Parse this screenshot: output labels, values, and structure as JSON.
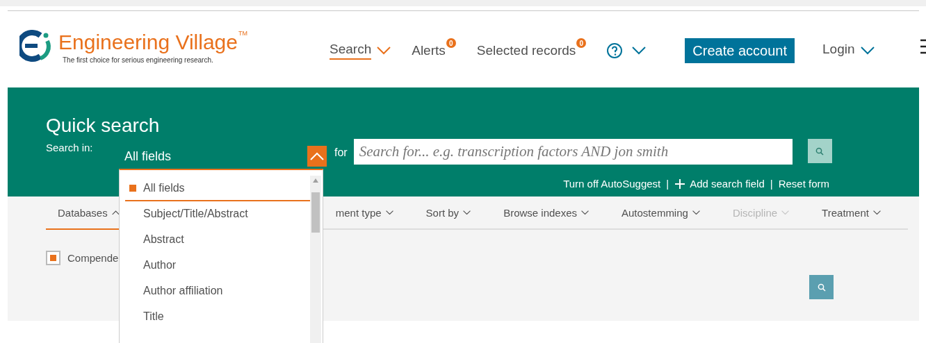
{
  "brand": {
    "name": "Engineering Village",
    "trademark": "TM",
    "tagline": "The first choice for serious engineering research."
  },
  "nav": [
    {
      "kind": "menu",
      "label": "Search",
      "selected": true
    },
    {
      "kind": "badge",
      "label": "Alerts",
      "badge": "0"
    },
    {
      "kind": "badge",
      "label": "Selected records",
      "badge": "0"
    },
    {
      "kind": "help"
    },
    {
      "kind": "button",
      "label": "Create account"
    },
    {
      "kind": "menu",
      "label": "Login",
      "selected": false
    }
  ],
  "quick_search": {
    "title": "Quick search",
    "search_in_label": "Search in:",
    "field_value": "All fields",
    "dropdown_expanded": true,
    "for_label": "for",
    "placeholder": "Search for... e.g. transcription factors AND jon smith",
    "links": [
      {
        "kind": "link",
        "label": "Turn off AutoSuggest"
      },
      {
        "kind": "separator",
        "label": "|"
      },
      {
        "kind": "add",
        "label": "Add search field"
      },
      {
        "kind": "separator",
        "label": "|"
      },
      {
        "kind": "link",
        "label": "Reset form"
      }
    ]
  },
  "filters": [
    {
      "label": "Databases",
      "selected": true,
      "disabled": false,
      "expanded": true
    },
    {
      "label": "ment type",
      "selected": false,
      "disabled": false,
      "expanded": false
    },
    {
      "label": "Sort by",
      "selected": false,
      "disabled": false,
      "expanded": false
    },
    {
      "label": "Browse indexes",
      "selected": false,
      "disabled": false,
      "expanded": false
    },
    {
      "label": "Autostemming",
      "selected": false,
      "disabled": false,
      "expanded": false
    },
    {
      "label": "Discipline",
      "selected": false,
      "disabled": true,
      "expanded": false
    },
    {
      "label": "Treatment",
      "selected": false,
      "disabled": false,
      "expanded": false
    }
  ],
  "databases": [
    {
      "label": "Compende",
      "checked": true
    }
  ],
  "dropdown_options": [
    {
      "label": "All fields",
      "selected": true
    },
    {
      "label": "Subject/Title/Abstract",
      "selected": false
    },
    {
      "label": "Abstract",
      "selected": false
    },
    {
      "label": "Author",
      "selected": false
    },
    {
      "label": "Author affiliation",
      "selected": false
    },
    {
      "label": "Title",
      "selected": false
    }
  ]
}
